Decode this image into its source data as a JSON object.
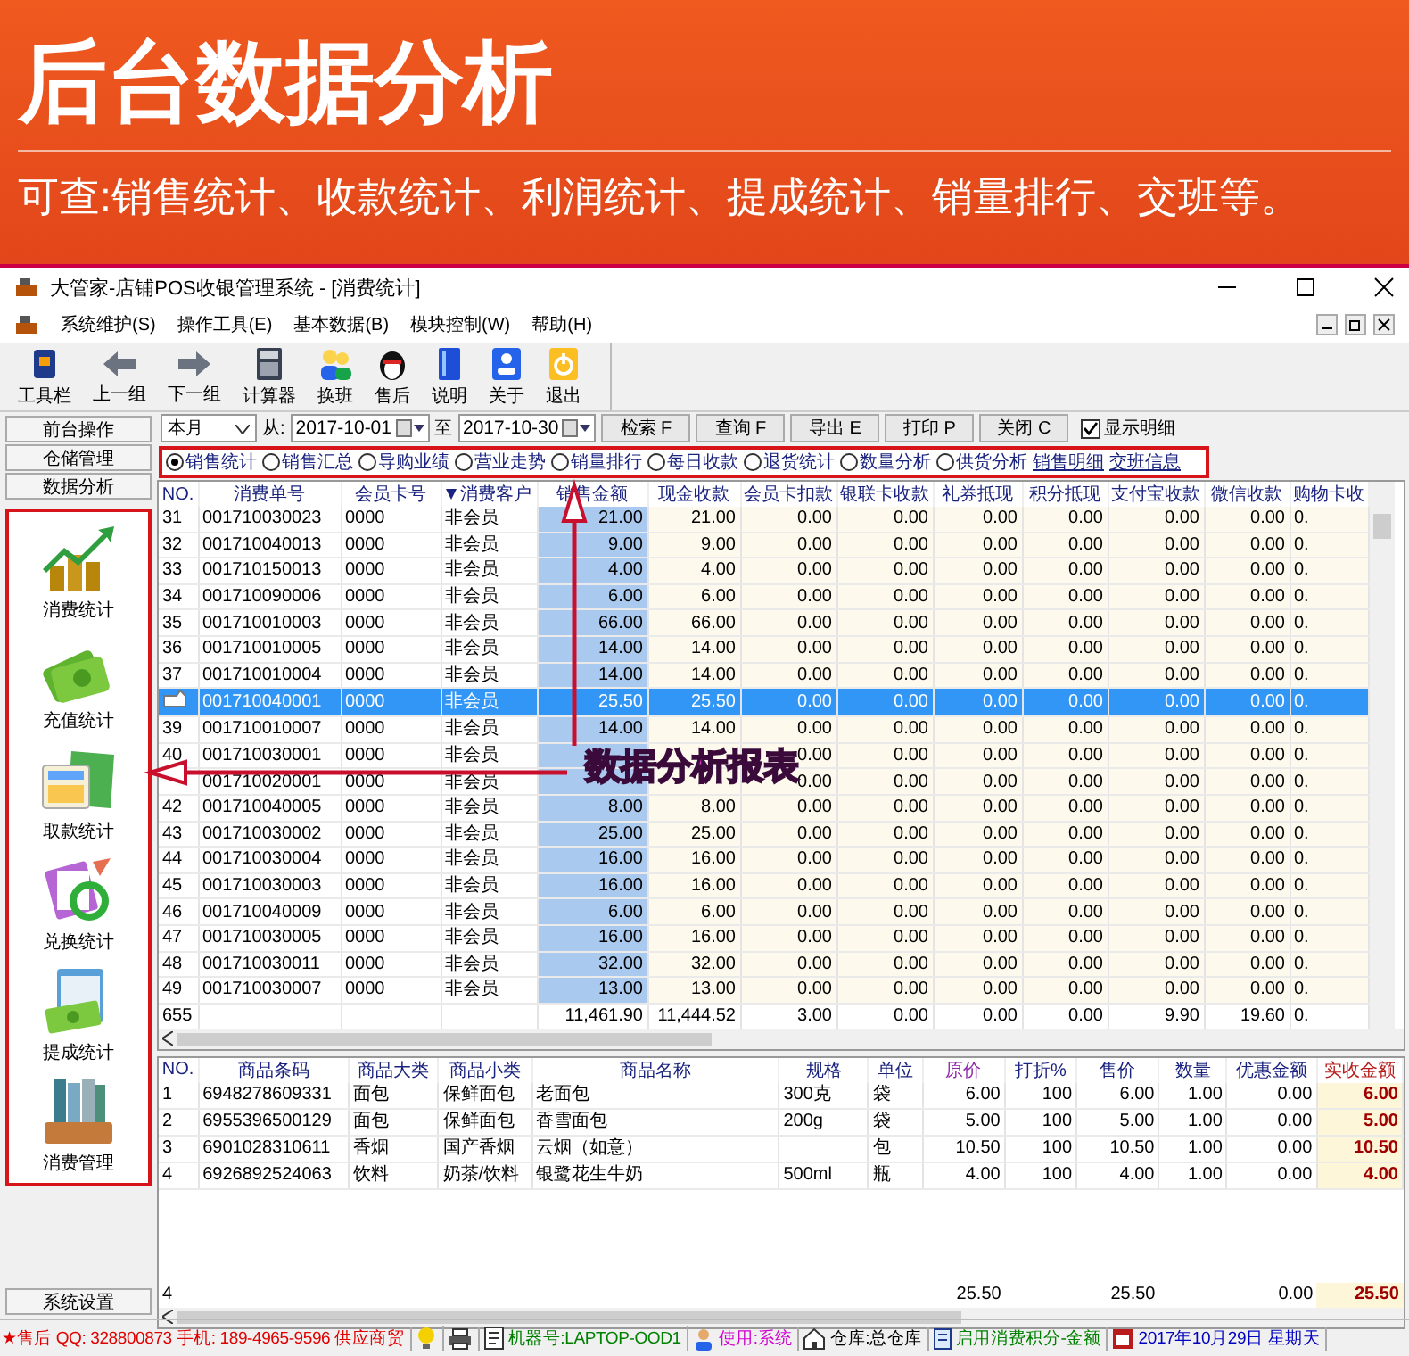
{
  "banner": {
    "title": "后台数据分析",
    "subtitle": "可查:销售统计、收款统计、利润统计、提成统计、销量排行、交班等。"
  },
  "window": {
    "title": "大管家-店铺POS收银管理系统 - [消费统计]"
  },
  "menu": [
    "系统维护(S)",
    "操作工具(E)",
    "基本数据(B)",
    "模块控制(W)",
    "帮助(H)"
  ],
  "toolbar": [
    "工具栏",
    "上一组",
    "下一组",
    "计算器",
    "换班",
    "售后",
    "说明",
    "关于",
    "退出"
  ],
  "sidebar": {
    "tabs": [
      "前台操作",
      "仓储管理",
      "数据分析"
    ],
    "items": [
      "消费统计",
      "充值统计",
      "取款统计",
      "兑换统计",
      "提成统计",
      "消费管理"
    ],
    "footer": "系统设置"
  },
  "filter": {
    "period": "本月",
    "from_label": "从:",
    "from": "2017-10-01",
    "to_label": "至",
    "to": "2017-10-30",
    "buttons": [
      "检索 F",
      "查询 F",
      "导出 E",
      "打印 P",
      "关闭 C"
    ],
    "show_detail": {
      "label": "显示明细",
      "checked": true
    }
  },
  "report_types": [
    {
      "kind": "radio",
      "label": "销售统计",
      "selected": true
    },
    {
      "kind": "radio",
      "label": "销售汇总",
      "selected": false
    },
    {
      "kind": "radio",
      "label": "导购业绩",
      "selected": false
    },
    {
      "kind": "radio",
      "label": "营业走势",
      "selected": false
    },
    {
      "kind": "radio",
      "label": "销量排行",
      "selected": false
    },
    {
      "kind": "radio",
      "label": "每日收款",
      "selected": false
    },
    {
      "kind": "radio",
      "label": "退货统计",
      "selected": false
    },
    {
      "kind": "radio",
      "label": "数量分析",
      "selected": false
    },
    {
      "kind": "radio",
      "label": "供货分析",
      "selected": false
    },
    {
      "kind": "link",
      "label": "销售明细"
    },
    {
      "kind": "link",
      "label": "交班信息"
    }
  ],
  "sales_table": {
    "columns": [
      "NO.",
      "消费单号",
      "会员卡号",
      "消费客户",
      "销售金额",
      "现金收款",
      "会员卡扣款",
      "银联卡收款",
      "礼券抵现",
      "积分抵现",
      "支付宝收款",
      "微信收款",
      "购物卡收"
    ],
    "rows": [
      {
        "selected": false,
        "cells": [
          "31",
          "001710030023",
          "0000",
          "非会员",
          "21.00",
          "21.00",
          "0.00",
          "0.00",
          "0.00",
          "0.00",
          "0.00",
          "0.00",
          "0."
        ]
      },
      {
        "selected": false,
        "cells": [
          "32",
          "001710040013",
          "0000",
          "非会员",
          "9.00",
          "9.00",
          "0.00",
          "0.00",
          "0.00",
          "0.00",
          "0.00",
          "0.00",
          "0."
        ]
      },
      {
        "selected": false,
        "cells": [
          "33",
          "001710150013",
          "0000",
          "非会员",
          "4.00",
          "4.00",
          "0.00",
          "0.00",
          "0.00",
          "0.00",
          "0.00",
          "0.00",
          "0."
        ]
      },
      {
        "selected": false,
        "cells": [
          "34",
          "001710090006",
          "0000",
          "非会员",
          "6.00",
          "6.00",
          "0.00",
          "0.00",
          "0.00",
          "0.00",
          "0.00",
          "0.00",
          "0."
        ]
      },
      {
        "selected": false,
        "cells": [
          "35",
          "001710010003",
          "0000",
          "非会员",
          "66.00",
          "66.00",
          "0.00",
          "0.00",
          "0.00",
          "0.00",
          "0.00",
          "0.00",
          "0."
        ]
      },
      {
        "selected": false,
        "cells": [
          "36",
          "001710010005",
          "0000",
          "非会员",
          "14.00",
          "14.00",
          "0.00",
          "0.00",
          "0.00",
          "0.00",
          "0.00",
          "0.00",
          "0."
        ]
      },
      {
        "selected": false,
        "cells": [
          "37",
          "001710010004",
          "0000",
          "非会员",
          "14.00",
          "14.00",
          "0.00",
          "0.00",
          "0.00",
          "0.00",
          "0.00",
          "0.00",
          "0."
        ]
      },
      {
        "selected": true,
        "cells": [
          null,
          "001710040001",
          "0000",
          "非会员",
          "25.50",
          "25.50",
          "0.00",
          "0.00",
          "0.00",
          "0.00",
          "0.00",
          "0.00",
          "0."
        ]
      },
      {
        "selected": false,
        "cells": [
          "39",
          "001710010007",
          "0000",
          "非会员",
          "14.00",
          "14.00",
          "0.00",
          "0.00",
          "0.00",
          "0.00",
          "0.00",
          "0.00",
          "0."
        ]
      },
      {
        "selected": false,
        "cells": [
          "40",
          "001710030001",
          "0000",
          "非会员",
          null,
          null,
          "0.00",
          "0.00",
          "0.00",
          "0.00",
          "0.00",
          "0.00",
          "0."
        ]
      },
      {
        "selected": false,
        "cells": [
          null,
          "001710020001",
          "0000",
          "非会员",
          null,
          null,
          "0.00",
          "0.00",
          "0.00",
          "0.00",
          "0.00",
          "0.00",
          "0."
        ]
      },
      {
        "selected": false,
        "cells": [
          "42",
          "001710040005",
          "0000",
          "非会员",
          "8.00",
          "8.00",
          "0.00",
          "0.00",
          "0.00",
          "0.00",
          "0.00",
          "0.00",
          "0."
        ]
      },
      {
        "selected": false,
        "cells": [
          "43",
          "001710030002",
          "0000",
          "非会员",
          "25.00",
          "25.00",
          "0.00",
          "0.00",
          "0.00",
          "0.00",
          "0.00",
          "0.00",
          "0."
        ]
      },
      {
        "selected": false,
        "cells": [
          "44",
          "001710030004",
          "0000",
          "非会员",
          "16.00",
          "16.00",
          "0.00",
          "0.00",
          "0.00",
          "0.00",
          "0.00",
          "0.00",
          "0."
        ]
      },
      {
        "selected": false,
        "cells": [
          "45",
          "001710030003",
          "0000",
          "非会员",
          "16.00",
          "16.00",
          "0.00",
          "0.00",
          "0.00",
          "0.00",
          "0.00",
          "0.00",
          "0."
        ]
      },
      {
        "selected": false,
        "cells": [
          "46",
          "001710040009",
          "0000",
          "非会员",
          "6.00",
          "6.00",
          "0.00",
          "0.00",
          "0.00",
          "0.00",
          "0.00",
          "0.00",
          "0."
        ]
      },
      {
        "selected": false,
        "cells": [
          "47",
          "001710030005",
          "0000",
          "非会员",
          "16.00",
          "16.00",
          "0.00",
          "0.00",
          "0.00",
          "0.00",
          "0.00",
          "0.00",
          "0."
        ]
      },
      {
        "selected": false,
        "cells": [
          "48",
          "001710030011",
          "0000",
          "非会员",
          "32.00",
          "32.00",
          "0.00",
          "0.00",
          "0.00",
          "0.00",
          "0.00",
          "0.00",
          "0."
        ]
      },
      {
        "selected": false,
        "cells": [
          "49",
          "001710030007",
          "0000",
          "非会员",
          "13.00",
          "13.00",
          "0.00",
          "0.00",
          "0.00",
          "0.00",
          "0.00",
          "0.00",
          "0."
        ]
      }
    ],
    "totals": {
      "no": "655",
      "sales": "11,461.90",
      "cash": "11,444.52",
      "member_card": "3.00",
      "unionpay": "0.00",
      "coupon": "0.00",
      "points": "0.00",
      "alipay": "9.90",
      "wechat": "19.60",
      "shopping_card": "0."
    }
  },
  "detail_table": {
    "columns": [
      "NO.",
      "商品条码",
      "商品大类",
      "商品小类",
      "商品名称",
      "规格",
      "单位",
      "原价",
      "打折%",
      "售价",
      "数量",
      "优惠金额",
      "实收金额"
    ],
    "rows": [
      [
        "1",
        "6948278609331",
        "面包",
        "保鲜面包",
        "老面包",
        "300克",
        "袋",
        "6.00",
        "100",
        "6.00",
        "1.00",
        "0.00",
        "6.00"
      ],
      [
        "2",
        "6955396500129",
        "面包",
        "保鲜面包",
        "香雪面包",
        "200g",
        "袋",
        "5.00",
        "100",
        "5.00",
        "1.00",
        "0.00",
        "5.00"
      ],
      [
        "3",
        "6901028310611",
        "香烟",
        "国产香烟",
        "云烟（如意）",
        null,
        "包",
        "10.50",
        "100",
        "10.50",
        "1.00",
        "0.00",
        "10.50"
      ],
      [
        "4",
        "6926892524063",
        "饮料",
        "奶茶/饮料",
        "银鹭花生牛奶",
        "500ml",
        "瓶",
        "4.00",
        "100",
        "4.00",
        "1.00",
        "0.00",
        "4.00"
      ]
    ],
    "totals": {
      "no": "4",
      "original_price": "25.50",
      "price": "25.50",
      "discount_amount": "0.00",
      "paid": "25.50"
    }
  },
  "annotation": {
    "label": "数据分析报表"
  },
  "status_bar": [
    {
      "text": "★售后 QQ: 328800873  手机: 189-4965-9596  供应商贸",
      "color": "#e00000"
    },
    {
      "text": "机器号:LAPTOP-OOD1",
      "color": "#008000"
    },
    {
      "text": "使用:系统",
      "color": "#d000d0"
    },
    {
      "text": "仓库:总仓库",
      "color": "#000000"
    },
    {
      "text": "启用消费积分-金额",
      "color": "#008000"
    },
    {
      "text": "2017年10月29日  星期天",
      "color": "#0000c0"
    }
  ]
}
